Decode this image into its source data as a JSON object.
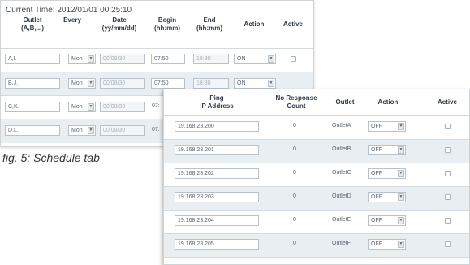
{
  "schedule": {
    "current_time": "Current Time: 2012/01/01 00:25:10",
    "headers": {
      "outlet": "Outlet\n(A,B,...)",
      "every": "Every",
      "date": "Date\n(yy/mm/dd)",
      "begin": "Begin\n(hh:mm)",
      "end": "End\n(hh:mm)",
      "action": "Action",
      "active": "Active"
    },
    "rows": [
      {
        "outlet": "A,I.",
        "every": "Mon",
        "date": "00/08/30",
        "begin": "07:50",
        "end": "18:30",
        "action": "ON"
      },
      {
        "outlet": "B,J.",
        "every": "Mon",
        "date": "00/08/30",
        "begin": "07:50",
        "end": "18:30",
        "action": "ON"
      },
      {
        "outlet": "C,K.",
        "every": "Mon",
        "date": "00/08/30",
        "begin": "07:",
        "end": "",
        "action": ""
      },
      {
        "outlet": "D,L.",
        "every": "Mon",
        "date": "00/08/30",
        "begin": "07:",
        "end": "",
        "action": ""
      }
    ]
  },
  "ping": {
    "headers": {
      "ip": "Ping\nIP Address",
      "count": "No Response\nCount",
      "outlet": "Outlet",
      "action": "Action",
      "active": "Active"
    },
    "rows": [
      {
        "ip": "19.168.23.200",
        "count": "0",
        "outlet": "OutletA",
        "action": "OFF"
      },
      {
        "ip": "19.168.23.201",
        "count": "0",
        "outlet": "OutletB",
        "action": "OFF"
      },
      {
        "ip": "19.168.23.202",
        "count": "0",
        "outlet": "OutletC",
        "action": "OFF"
      },
      {
        "ip": "19.168.23.203",
        "count": "0",
        "outlet": "OutletD",
        "action": "OFF"
      },
      {
        "ip": "19.168.23.204",
        "count": "0",
        "outlet": "OutletE",
        "action": "OFF"
      },
      {
        "ip": "19.168.23.205",
        "count": "0",
        "outlet": "OutletF",
        "action": "OFF"
      }
    ]
  },
  "caption": "fig. 5: Schedule tab"
}
